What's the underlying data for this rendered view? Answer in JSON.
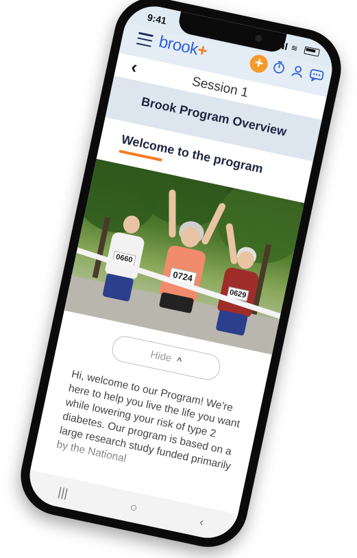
{
  "status_bar": {
    "time": "9:41"
  },
  "header": {
    "logo_main": "brook",
    "logo_plus": "+",
    "add_glyph": "+",
    "icons": [
      "menu-icon",
      "timer-icon",
      "profile-icon",
      "chat-icon"
    ]
  },
  "nav": {
    "back_glyph": "‹",
    "session_title": "Session 1"
  },
  "content": {
    "overview_title": "Brook Program Overview",
    "section_title": "Welcome to the program",
    "hide_label": "Hide",
    "hide_chevron": "^",
    "paragraph": "Hi, welcome to our Program! We're here to help you live the life you want while lowering your risk of type 2 diabetes. Our program is based on a large research study funded primarily by the National"
  },
  "hero": {
    "bib_left": "0660",
    "bib_center": "0724",
    "bib_right": "0629"
  },
  "system_nav": {
    "recents": "|||",
    "home": "○",
    "back": "‹"
  },
  "colors": {
    "brand_blue": "#2f5fd7",
    "accent_orange": "#f47c22",
    "header_bg": "#e4edf5",
    "band_bg": "#dde6ee"
  }
}
